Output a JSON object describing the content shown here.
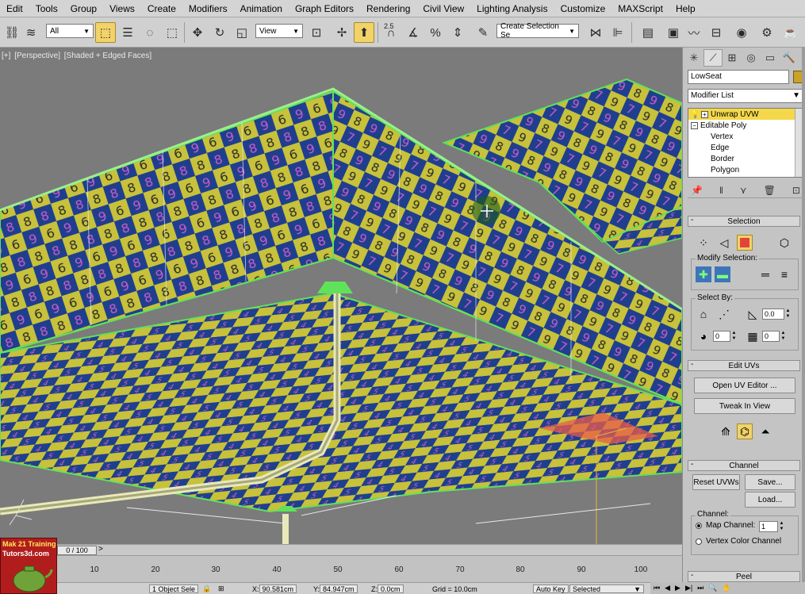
{
  "menu": [
    "Edit",
    "Tools",
    "Group",
    "Views",
    "Create",
    "Modifiers",
    "Animation",
    "Graph Editors",
    "Rendering",
    "Civil View",
    "Lighting Analysis",
    "Customize",
    "MAXScript",
    "Help"
  ],
  "toolbar": {
    "selection_filter": "All",
    "ref_coord": "View",
    "snap_angle_label": "2.5",
    "named_selection_placeholder": "Create Selection Se",
    "icons": [
      "undo-icon",
      "link-icon",
      "select-object-icon",
      "select-by-name-icon",
      "rect-region-icon",
      "window-crossing-icon",
      "move-icon",
      "rotate-icon",
      "scale-icon",
      "pivot-icon",
      "select-manipulate-icon",
      "keyboard-shortcut-icon",
      "snap-icon",
      "angle-snap-icon",
      "percent-snap-icon",
      "spinner-snap-icon",
      "edit-named-sets-icon",
      "mirror-icon",
      "align-icon",
      "layer-icon",
      "curve-editor-icon",
      "schematic-icon",
      "material-editor-icon",
      "render-setup-icon",
      "render-frame-icon",
      "render-icon"
    ]
  },
  "viewport": {
    "label_parts": [
      "[+]",
      "[Perspective]",
      "[Shaded + Edged Faces]"
    ],
    "colors": {
      "bg": "#7b7b7b",
      "yellow_tile": "#c7c13b",
      "blue_tile": "#1f3f8e",
      "wire": "#5fe25a",
      "pipe": "#d8d9a8"
    }
  },
  "watermark": {
    "line1": "Mak 21 Training",
    "line2": "Tutors3d.com"
  },
  "timeline": {
    "slider": "0 / 100",
    "arrow": ">",
    "ticks": [
      "10",
      "20",
      "30",
      "40",
      "50",
      "60",
      "70",
      "80",
      "90",
      "100"
    ]
  },
  "status": {
    "selection_info": "1 Object Sele",
    "x_label": "X:",
    "x_value": "90.581cm",
    "y_label": "Y:",
    "y_value": "84.947cm",
    "z_label": "Z:",
    "z_value": "0.0cm",
    "grid": "Grid = 10.0cm",
    "autokey": "Auto Key",
    "selected_dropdown": "Selected"
  },
  "command_panel": {
    "tabs": [
      "create-tab-icon",
      "modify-tab-icon",
      "hierarchy-tab-icon",
      "motion-tab-icon",
      "display-tab-icon",
      "utilities-tab-icon"
    ],
    "object_name": "LowSeat",
    "object_color": "#c9a227",
    "modifier_list_label": "Modifier List",
    "stack": [
      {
        "label": "Unwrap UVW",
        "selected": true
      },
      {
        "label": "Editable Poly",
        "selected": false
      },
      {
        "label": "Vertex",
        "selected": false
      },
      {
        "label": "Edge",
        "selected": false
      },
      {
        "label": "Border",
        "selected": false
      },
      {
        "label": "Polygon",
        "selected": false
      }
    ]
  },
  "selection_rollout": {
    "title": "Selection",
    "modify_selection_label": "Modify Selection:",
    "select_by_label": "Select By:",
    "threshold_value": "0.0",
    "ring_value": "0",
    "loop_value": "0"
  },
  "edit_uvs_rollout": {
    "title": "Edit UVs",
    "open_uv_editor": "Open UV Editor ...",
    "tweak_in_view": "Tweak In View"
  },
  "channel_rollout": {
    "title": "Channel",
    "reset_uvws": "Reset UVWs",
    "save": "Save...",
    "load": "Load...",
    "channel_group_label": "Channel:",
    "map_channel_label": "Map Channel:",
    "map_channel_value": "1",
    "vertex_color_channel_label": "Vertex Color Channel"
  },
  "peel_rollout": {
    "title": "Peel"
  }
}
